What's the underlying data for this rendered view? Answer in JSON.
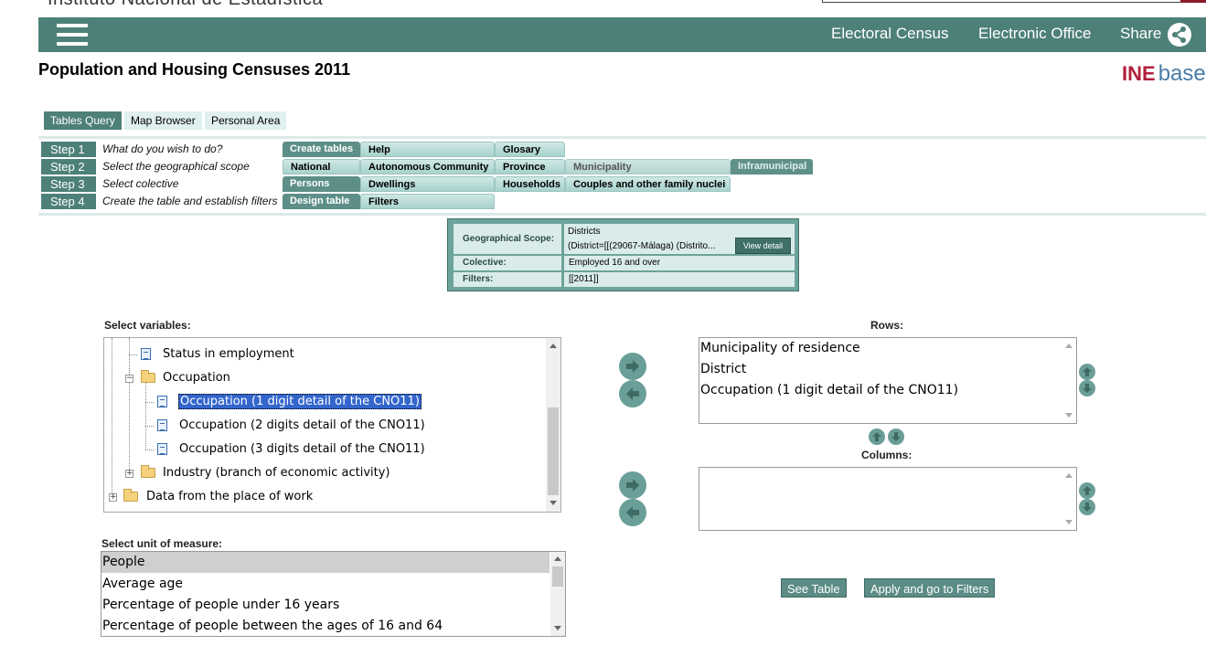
{
  "site": {
    "name": "Instituto Nacional de Estadística"
  },
  "header": {
    "links": [
      "Electoral Census",
      "Electronic Office",
      "Share"
    ]
  },
  "page": {
    "title": "Population and Housing Censuses 2011",
    "logo_ine": "INE",
    "logo_base": "base"
  },
  "top_tabs": [
    "Tables Query",
    "Map Browser",
    "Personal Area"
  ],
  "steps": [
    {
      "label": "Step 1",
      "desc": "What do you wish to do?",
      "tabs": [
        "Create tables",
        "Help",
        "Glosary"
      ]
    },
    {
      "label": "Step 2",
      "desc": "Select the geographical scope",
      "tabs": [
        "National",
        "Autonomous Community",
        "Province",
        "Municipality",
        "Inframunicipal"
      ]
    },
    {
      "label": "Step 3",
      "desc": "Select colective",
      "tabs": [
        "Persons",
        "Dwellings",
        "Households",
        "Couples and other family nuclei"
      ]
    },
    {
      "label": "Step 4",
      "desc": "Create the table and establish filters",
      "tabs": [
        "Design table",
        "Filters"
      ]
    }
  ],
  "summary": {
    "geo_label": "Geographical Scope:",
    "geo_value_1": "Districts",
    "geo_value_2": "(District=[[(29067-Málaga) (Distrito...",
    "view_detail": "View detail",
    "colective_label": "Colective:",
    "colective_value": "Employed 16 and over",
    "filters_label": "Filters:",
    "filters_value": "[[2011]]"
  },
  "variables": {
    "label": "Select variables:",
    "items": [
      "Status in employment",
      "Occupation",
      "Occupation (1 digit detail of the CNO11)",
      "Occupation (2 digits detail of the CNO11)",
      "Occupation (3 digits detail of the CNO11)",
      "Industry (branch of economic activity)",
      "Data from the place of work"
    ]
  },
  "rows": {
    "label": "Rows:",
    "items": [
      "Municipality of residence",
      "District",
      "Occupation (1 digit detail of the CNO11)"
    ]
  },
  "columns": {
    "label": "Columns:"
  },
  "measure": {
    "label": "Select unit of measure:",
    "items": [
      "People",
      "Average age",
      "Percentage of people under 16 years",
      "Percentage of people between the ages of 16 and 64"
    ]
  },
  "actions": {
    "see_table": "See Table",
    "apply_filters": "Apply and go to Filters"
  },
  "colors": {
    "brand": "#4d8078",
    "ine_red": "#b0203b",
    "selection": "#3366cc"
  }
}
